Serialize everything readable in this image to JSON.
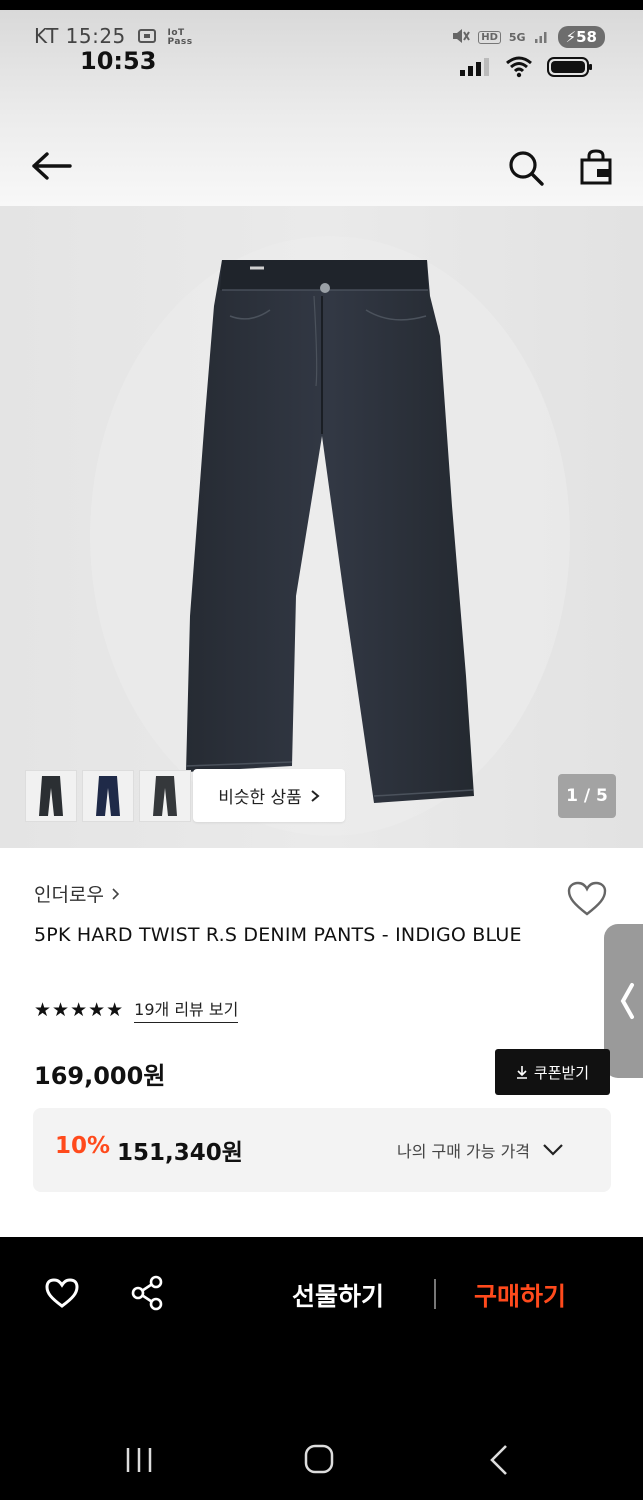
{
  "status_bar": {
    "carrier_time": "KT 15:25",
    "iot_label": "IoT Pass",
    "clock": "10:53",
    "hd_label": "HD",
    "network_label": "5G",
    "battery_level": "58"
  },
  "header": {
    "back_icon": "arrow-left-icon",
    "search_icon": "search-icon",
    "bag_icon": "shopping-bag-icon"
  },
  "gallery": {
    "similar_label": "비슷한 상품",
    "counter": "1 / 5",
    "thumbnails": [
      "thumb-black",
      "thumb-navy",
      "thumb-charcoal"
    ],
    "thumb_colors": [
      "#2b2f33",
      "#1f2a48",
      "#35383b"
    ]
  },
  "product": {
    "brand": "인더로우",
    "title": "5PK HARD TWIST R.S DENIM PANTS - INDIGO BLUE",
    "stars": "★★★★★",
    "review_link": "19개 리뷰 보기",
    "price": "169,000원",
    "coupon_label": "쿠폰받기",
    "discount_rate": "10%",
    "discount_price": "151,340원",
    "my_price_label": "나의 구매 가능 가격"
  },
  "bottom_bar": {
    "gift_label": "선물하기",
    "buy_label": "구매하기"
  },
  "colors": {
    "accent": "#ff4a1c",
    "dark": "#111111",
    "denim": "#2a2f38"
  }
}
